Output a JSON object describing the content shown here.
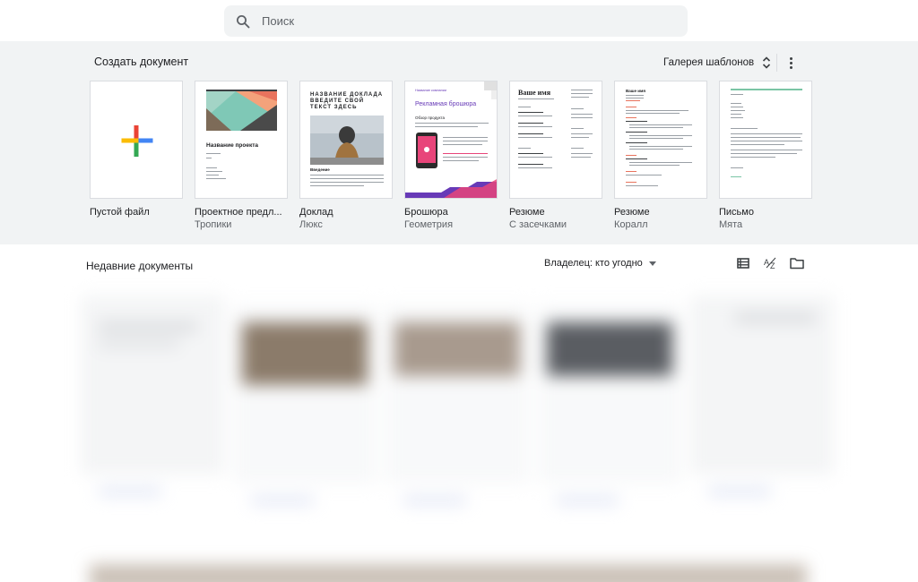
{
  "search": {
    "placeholder": "Поиск"
  },
  "gallery": {
    "title": "Создать документ",
    "gallery_button": "Галерея шаблонов",
    "templates": [
      {
        "name": "Пустой файл",
        "subtitle": ""
      },
      {
        "name": "Проектное предл...",
        "subtitle": "Тропики",
        "thumb_title": "Название проекта"
      },
      {
        "name": "Доклад",
        "subtitle": "Люкс",
        "thumb_title": "НАЗВАНИЕ ДОКЛАДА ВВЕДИТЕ СВОЙ ТЕКСТ ЗДЕСЬ",
        "thumb_section": "Введение"
      },
      {
        "name": "Брошюра",
        "subtitle": "Геометрия",
        "thumb_company": "Название компании",
        "thumb_title": "Рекламная брошюра",
        "thumb_section": "Обзор продукта"
      },
      {
        "name": "Резюме",
        "subtitle": "С засечками",
        "thumb_title": "Ваше имя"
      },
      {
        "name": "Резюме",
        "subtitle": "Коралл",
        "thumb_title": "Ваше имя"
      },
      {
        "name": "Письмо",
        "subtitle": "Мята"
      }
    ]
  },
  "recent": {
    "title": "Недавние документы",
    "owner_filter": "Владелец: кто угодно"
  },
  "icons": [
    "search-icon",
    "unfold-icon",
    "more-vert-icon",
    "list-view-icon",
    "sort-az-icon",
    "folder-icon",
    "plus-icon"
  ],
  "colors": {
    "google_blue": "#4285f4",
    "google_red": "#ea4335",
    "google_yellow": "#fbbc04",
    "google_green": "#34a853",
    "accent_purple": "#673ab7",
    "mint": "#7ac5a5"
  }
}
